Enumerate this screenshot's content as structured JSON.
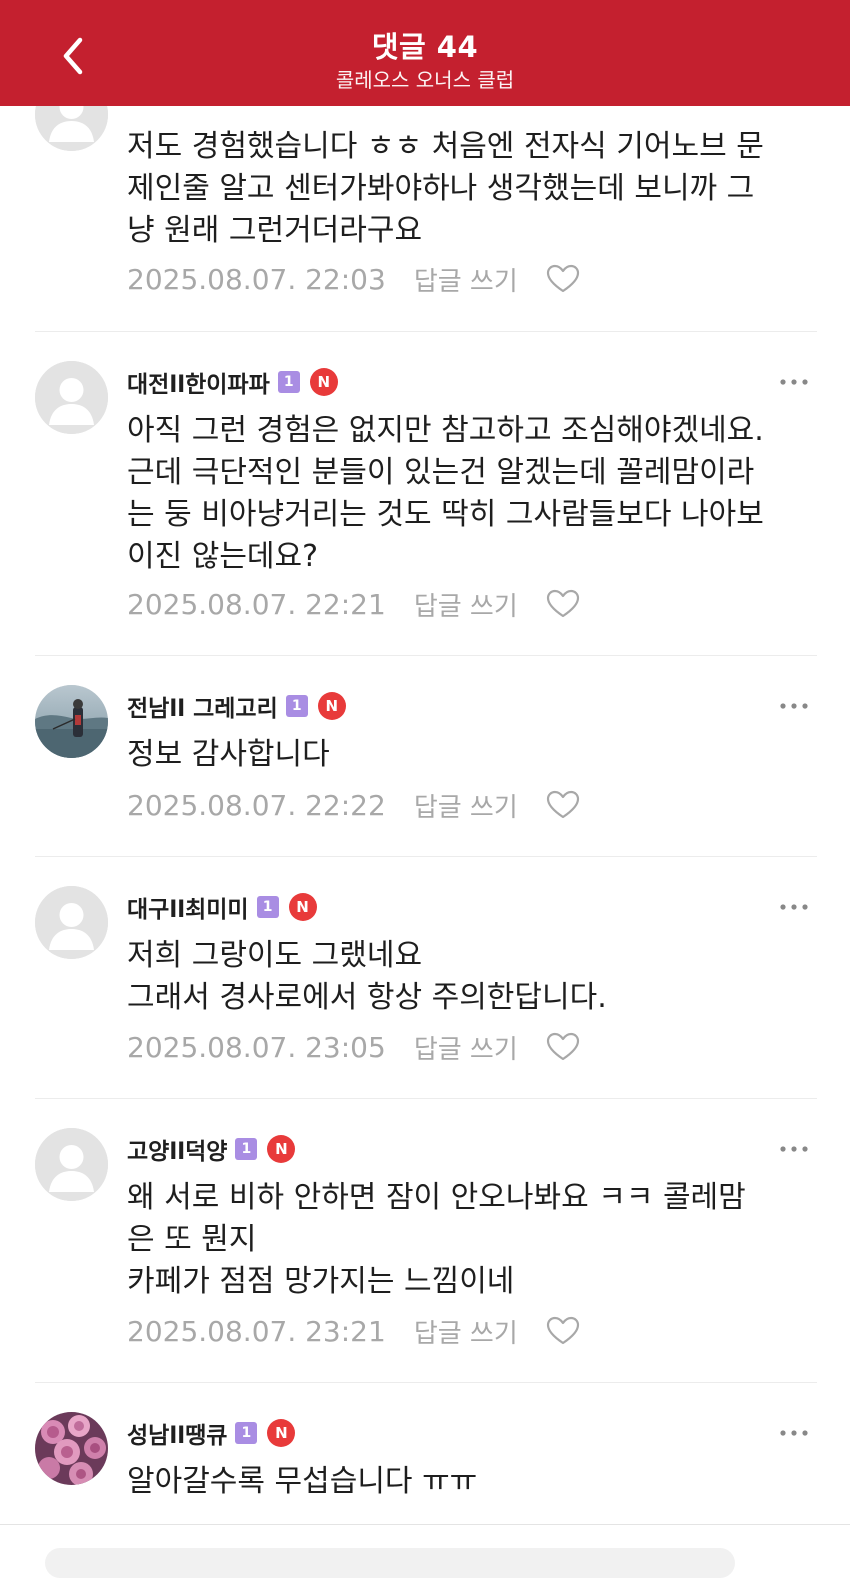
{
  "header": {
    "title": "댓글 44",
    "subtitle": "콜레오스 오너스 클럽"
  },
  "common": {
    "reply_label": "답글 쓰기",
    "level_badge": "1",
    "new_badge": "N"
  },
  "comments": [
    {
      "nickname": "",
      "text": "저도 경험했습니다 ㅎㅎ 처음엔 전자식 기어노브 문\n제인줄 알고 센터가봐야하나 생각했는데  보니까 그\n냥 원래 그런거더라구요",
      "date": "2025.08.07. 22:03",
      "avatar": "default-avatar"
    },
    {
      "nickname": "대전ll한이파파",
      "text": "아직 그런 경험은 없지만 참고하고 조심해야겠네요.\n근데 극단적인 분들이 있는건 알겠는데 꼴레맘이라\n는 둥 비아냥거리는 것도 딱히 그사람들보다 나아보\n이진 않는데요?",
      "date": "2025.08.07. 22:21",
      "avatar": "default-avatar"
    },
    {
      "nickname": "전남ll 그레고리",
      "text": "정보 감사합니다",
      "date": "2025.08.07. 22:22",
      "avatar": "fishing-photo-avatar"
    },
    {
      "nickname": "대구ll최미미",
      "text": "저희 그랑이도 그랬네요\n그래서 경사로에서  항상 주의한답니다.",
      "date": "2025.08.07. 23:05",
      "avatar": "default-avatar"
    },
    {
      "nickname": "고양ll덕양",
      "text": "왜 서로 비하 안하면 잠이 안오나봐요 ㅋㅋ 콜레맘\n은 또 뭔지\n카페가 점점 망가지는 느낌이네",
      "date": "2025.08.07. 23:21",
      "avatar": "default-avatar"
    },
    {
      "nickname": "성남ll땡큐",
      "text": "알아갈수록 무섭습니다 ㅠㅠ",
      "date": "",
      "avatar": "roses-photo-avatar"
    }
  ],
  "colors": {
    "header_bg": "#c4202f",
    "level_badge": "#a98de3",
    "new_badge": "#e83a3a",
    "meta_text": "#a8a8a8"
  }
}
